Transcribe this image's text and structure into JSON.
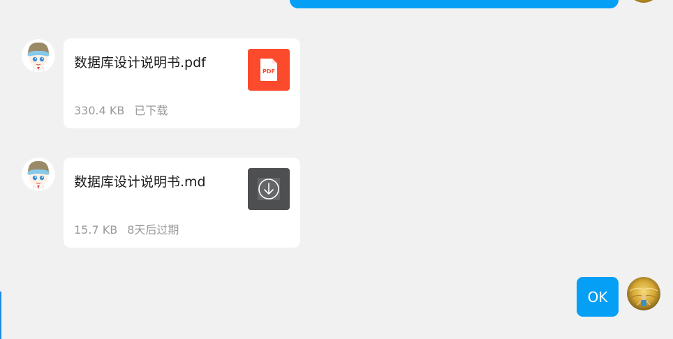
{
  "messages": [
    {
      "side": "left",
      "type": "file",
      "avatar": "contact-avatar",
      "file_name": "数据库设计说明书.pdf",
      "file_size": "330.4 KB",
      "status": "已下载",
      "icon": "pdf-file-icon",
      "icon_label": "PDF",
      "icon_color": "#fb4a2c"
    },
    {
      "side": "left",
      "type": "file",
      "avatar": "contact-avatar",
      "file_name": "数据库设计说明书.md",
      "file_size": "15.7 KB",
      "status": "8天后过期",
      "icon": "download-icon",
      "icon_color": "#4e4f51"
    },
    {
      "side": "right",
      "type": "text",
      "avatar": "self-avatar",
      "text": "OK"
    }
  ],
  "colors": {
    "background": "#f1f1f1",
    "self_bubble": "#05a0f5",
    "card": "#ffffff",
    "meta_text": "#9a9a9a"
  }
}
